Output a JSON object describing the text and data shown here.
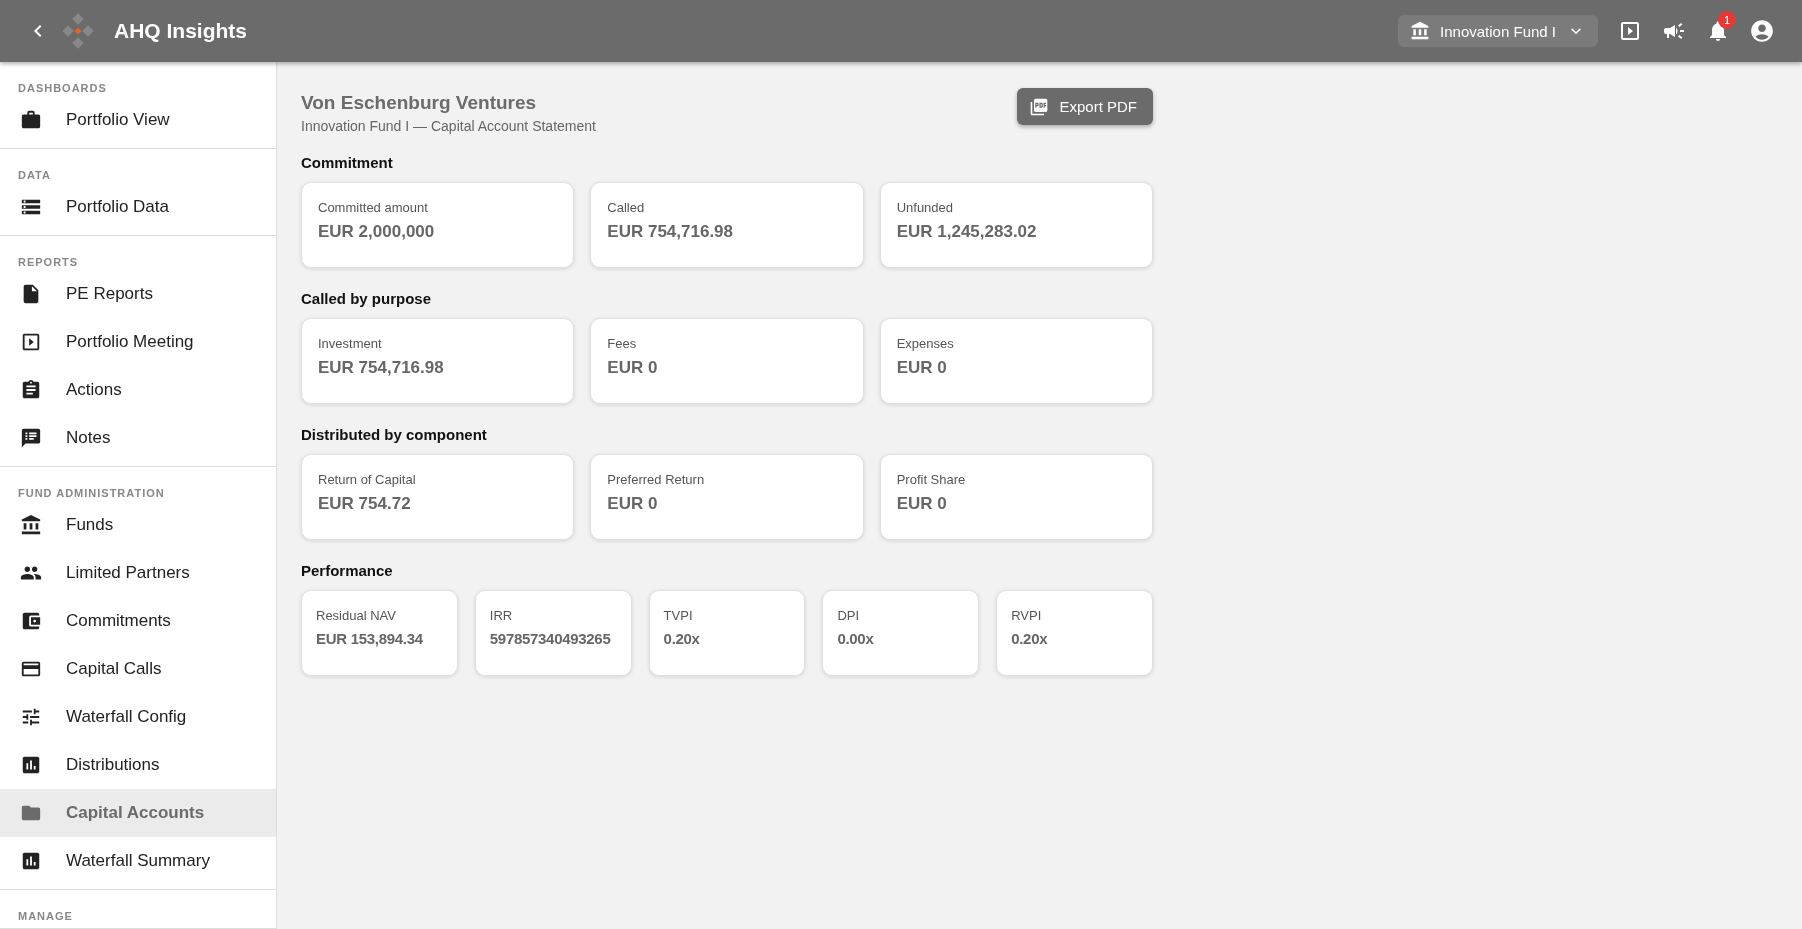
{
  "app_bar": {
    "title": "AHQ Insights",
    "fund_selector": "Innovation Fund I",
    "notification_count": "1"
  },
  "sidebar": {
    "sections": [
      {
        "label": "DASHBOARDS",
        "items": [
          {
            "label": "Portfolio View",
            "selected": false
          }
        ]
      },
      {
        "label": "DATA",
        "items": [
          {
            "label": "Portfolio Data",
            "selected": false
          }
        ]
      },
      {
        "label": "REPORTS",
        "items": [
          {
            "label": "PE Reports",
            "selected": false
          },
          {
            "label": "Portfolio Meeting",
            "selected": false
          },
          {
            "label": "Actions",
            "selected": false
          },
          {
            "label": "Notes",
            "selected": false
          }
        ]
      },
      {
        "label": "FUND ADMINISTRATION",
        "items": [
          {
            "label": "Funds",
            "selected": false
          },
          {
            "label": "Limited Partners",
            "selected": false
          },
          {
            "label": "Commitments",
            "selected": false
          },
          {
            "label": "Capital Calls",
            "selected": false
          },
          {
            "label": "Waterfall Config",
            "selected": false
          },
          {
            "label": "Distributions",
            "selected": false
          },
          {
            "label": "Capital Accounts",
            "selected": true
          },
          {
            "label": "Waterfall Summary",
            "selected": false
          }
        ]
      },
      {
        "label": "MANAGE"
      }
    ]
  },
  "header": {
    "title": "Von Eschenburg Ventures",
    "subtitle": "Innovation Fund I — Capital Account Statement",
    "export_button": "Export PDF"
  },
  "sections": [
    {
      "title": "Commitment",
      "cards": [
        {
          "label": "Committed amount",
          "value": "EUR 2,000,000"
        },
        {
          "label": "Called",
          "value": "EUR 754,716.98"
        },
        {
          "label": "Unfunded",
          "value": "EUR 1,245,283.02"
        }
      ]
    },
    {
      "title": "Called by purpose",
      "cards": [
        {
          "label": "Investment",
          "value": "EUR 754,716.98"
        },
        {
          "label": "Fees",
          "value": "EUR 0"
        },
        {
          "label": "Expenses",
          "value": "EUR 0"
        }
      ]
    },
    {
      "title": "Distributed by component",
      "cards": [
        {
          "label": "Return of Capital",
          "value": "EUR 754.72"
        },
        {
          "label": "Preferred Return",
          "value": "EUR 0"
        },
        {
          "label": "Profit Share",
          "value": "EUR 0"
        }
      ]
    },
    {
      "title": "Performance",
      "cards": [
        {
          "label": "Residual NAV",
          "value": "EUR 153,894.34"
        },
        {
          "label": "IRR",
          "value": "597857340493265"
        },
        {
          "label": "TVPI",
          "value": "0.20x"
        },
        {
          "label": "DPI",
          "value": "0.00x"
        },
        {
          "label": "RVPI",
          "value": "0.20x"
        }
      ]
    }
  ]
}
